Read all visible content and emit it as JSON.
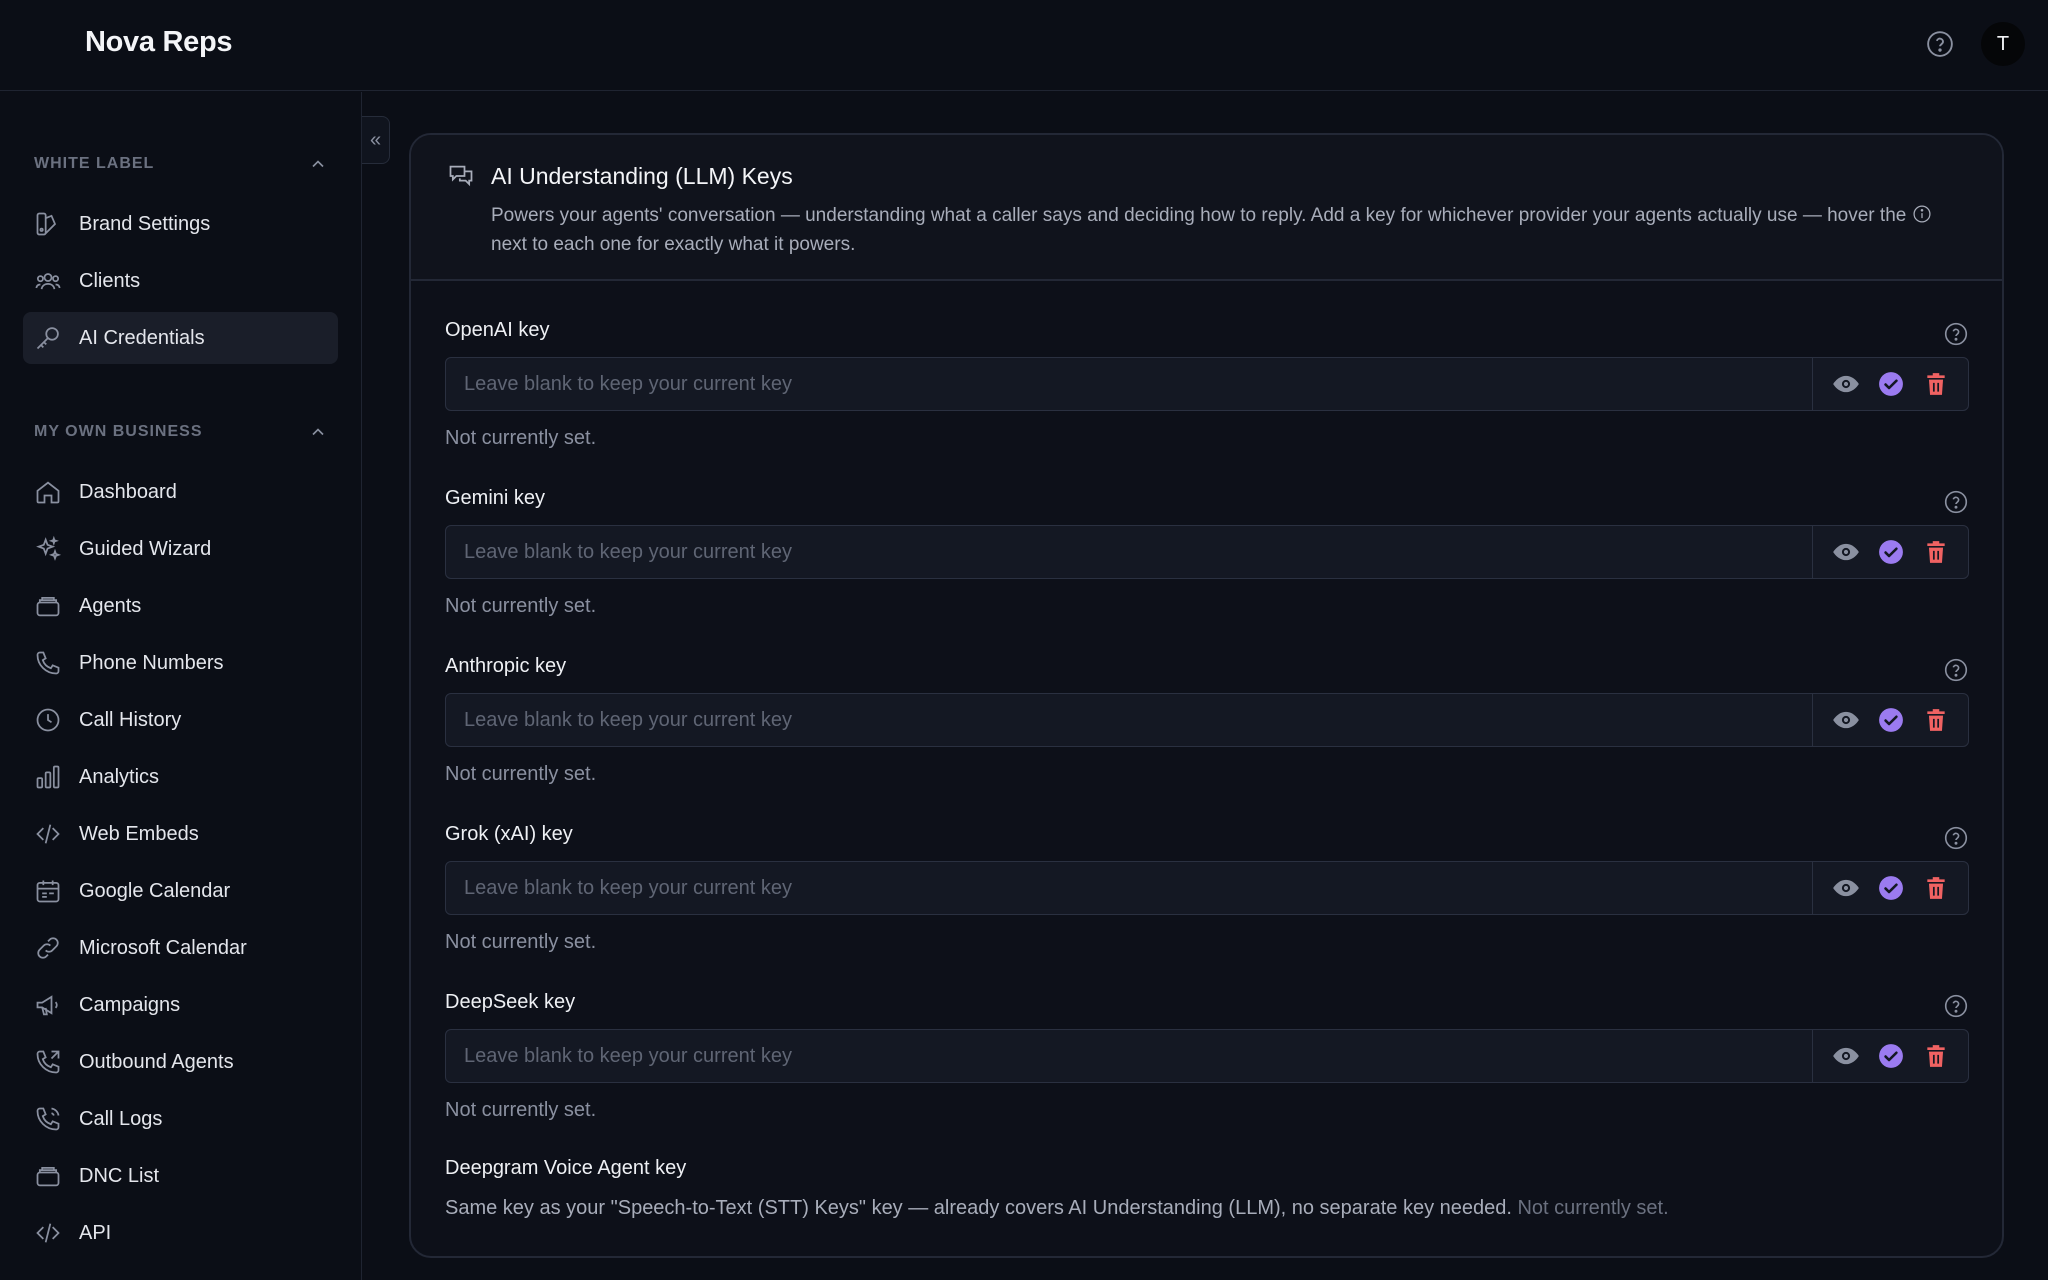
{
  "app": {
    "brand": "Nova Reps",
    "user_initial": "T"
  },
  "sidebar": {
    "collapse_glyph": "«",
    "sections": [
      {
        "label": "WHITE LABEL",
        "items": [
          {
            "label": "Brand Settings",
            "icon": "brand-settings-icon"
          },
          {
            "label": "Clients",
            "icon": "users-icon"
          },
          {
            "label": "AI Credentials",
            "icon": "key-icon",
            "active": true
          }
        ]
      },
      {
        "label": "MY OWN BUSINESS",
        "items": [
          {
            "label": "Dashboard",
            "icon": "home-icon"
          },
          {
            "label": "Guided Wizard",
            "icon": "sparkles-icon"
          },
          {
            "label": "Agents",
            "icon": "stack-icon"
          },
          {
            "label": "Phone Numbers",
            "icon": "phone-icon"
          },
          {
            "label": "Call History",
            "icon": "clock-icon"
          },
          {
            "label": "Analytics",
            "icon": "bar-chart-icon"
          },
          {
            "label": "Web Embeds",
            "icon": "code-icon"
          },
          {
            "label": "Google Calendar",
            "icon": "calendar-icon"
          },
          {
            "label": "Microsoft Calendar",
            "icon": "link-icon"
          },
          {
            "label": "Campaigns",
            "icon": "megaphone-icon"
          },
          {
            "label": "Outbound Agents",
            "icon": "phone-outgoing-icon"
          },
          {
            "label": "Call Logs",
            "icon": "phone-log-icon"
          },
          {
            "label": "DNC List",
            "icon": "stack-icon"
          },
          {
            "label": "API",
            "icon": "code-icon"
          }
        ]
      }
    ]
  },
  "card": {
    "title": "AI Understanding (LLM) Keys",
    "description_part1": "Powers your agents' conversation — understanding what a caller says and deciding how to reply. Add a key for whichever provider your agents actually use — hover the",
    "description_part2": "next to each one for exactly what it powers.",
    "keys": [
      {
        "label": "OpenAI key",
        "placeholder": "Leave blank to keep your current key",
        "status": "Not currently set."
      },
      {
        "label": "Gemini key",
        "placeholder": "Leave blank to keep your current key",
        "status": "Not currently set."
      },
      {
        "label": "Anthropic key",
        "placeholder": "Leave blank to keep your current key",
        "status": "Not currently set."
      },
      {
        "label": "Grok (xAI) key",
        "placeholder": "Leave blank to keep your current key",
        "status": "Not currently set."
      },
      {
        "label": "DeepSeek key",
        "placeholder": "Leave blank to keep your current key",
        "status": "Not currently set."
      }
    ],
    "deepgram": {
      "label": "Deepgram Voice Agent key",
      "note": "Same key as your \"Speech-to-Text (STT) Keys\" key — already covers AI Understanding (LLM), no separate key needed.",
      "status": "Not currently set."
    }
  },
  "colors": {
    "background": "#0b0e16",
    "accent_purple": "#9b7bf0",
    "delete_red": "#f06262",
    "icon_gray": "#8a90a0"
  }
}
